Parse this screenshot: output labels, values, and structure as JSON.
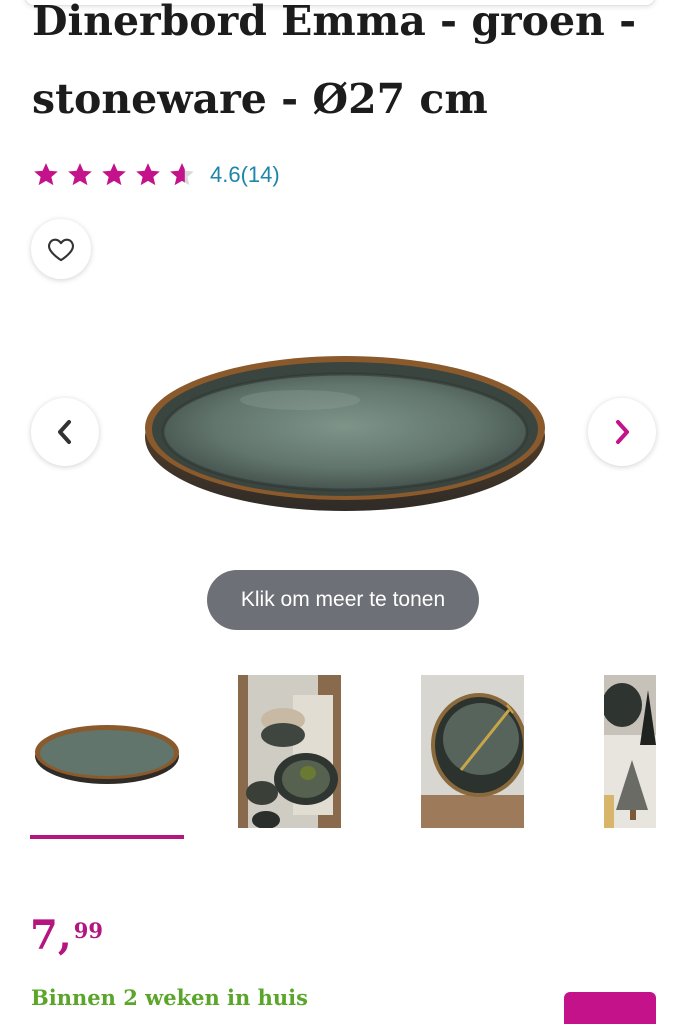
{
  "product": {
    "title_line1": "Dinerbord Emma - groen -",
    "title_line2": "stoneware - Ø27 cm",
    "rating": {
      "value_text": "4.6(14)",
      "score": 4.6,
      "max": 5,
      "star_color": "#c4128a"
    },
    "favorite_icon": "heart-outline-icon"
  },
  "gallery": {
    "prev_icon": "chevron-left-icon",
    "next_icon": "chevron-right-icon",
    "more_label": "Klik om meer te tonen",
    "thumbnail_count": 4,
    "selected_index": 0
  },
  "price": {
    "integer": "7",
    "comma": ",",
    "decimals": "99",
    "color": "#b5157e"
  },
  "delivery": {
    "text": "Binnen 2 weken in huis",
    "color": "#5aa52a"
  },
  "cart": {
    "color": "#c4128a"
  }
}
